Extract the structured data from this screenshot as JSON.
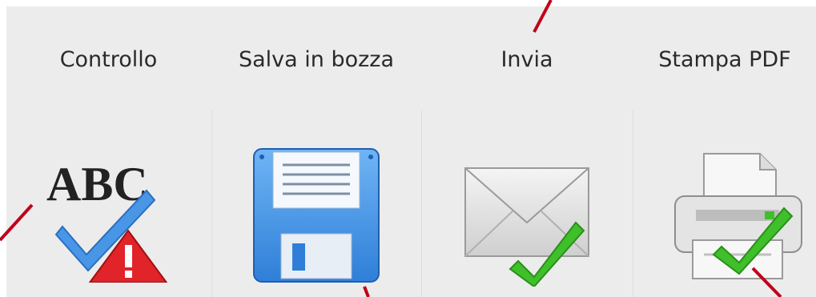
{
  "toolbar": {
    "buttons": [
      {
        "label": "Controllo",
        "icon": "spellcheck-warning-icon"
      },
      {
        "label": "Salva in bozza",
        "icon": "floppy-disk-icon"
      },
      {
        "label": "Invia",
        "icon": "envelope-check-icon"
      },
      {
        "label": "Stampa PDF",
        "icon": "printer-check-icon"
      }
    ],
    "spellcheck_icon_text": "ABC"
  },
  "colors": {
    "toolbar_bg": "#ececec",
    "annotation_arrow": "#c0001a",
    "floppy_blue": "#3a8de6",
    "check_green": "#3fbf2a",
    "warning_red": "#e0242a"
  }
}
